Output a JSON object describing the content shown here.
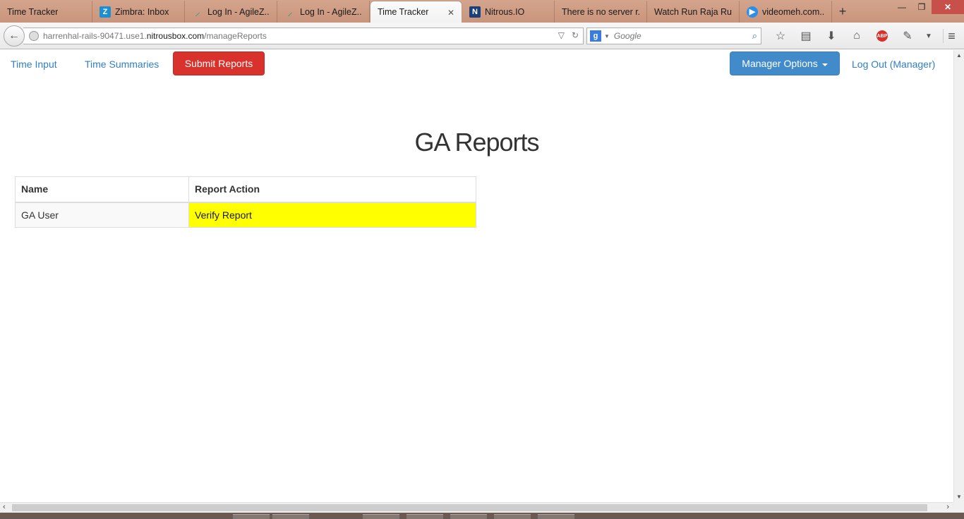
{
  "browser": {
    "tabs": [
      {
        "label": "Time Tracker",
        "icon": "none"
      },
      {
        "label": "Zimbra: Inbox",
        "icon": "zimbra-icon"
      },
      {
        "label": "Log In - AgileZ...",
        "icon": "agilezen-icon"
      },
      {
        "label": "Log In - AgileZ...",
        "icon": "agilezen-icon"
      },
      {
        "label": "Time Tracker",
        "icon": "none",
        "active": true
      },
      {
        "label": "Nitrous.IO",
        "icon": "nitrous-icon"
      },
      {
        "label": "There is no server r...",
        "icon": "none"
      },
      {
        "label": "Watch Run Raja Ru...",
        "icon": "none"
      },
      {
        "label": "videomeh.com...",
        "icon": "video-icon"
      }
    ],
    "url_prefix": "harrenhal-rails-90471.use1.",
    "url_domain": "nitrousbox.com",
    "url_path": "/manageReports",
    "search_placeholder": "Google"
  },
  "nav": {
    "time_input": "Time Input",
    "time_summaries": "Time Summaries",
    "submit_reports": "Submit Reports",
    "manager_options": "Manager Options",
    "log_out": "Log Out (Manager)"
  },
  "page": {
    "title": "GA Reports"
  },
  "table": {
    "headers": {
      "name": "Name",
      "action": "Report Action"
    },
    "rows": [
      {
        "name": "GA User",
        "action": "Verify Report"
      }
    ]
  },
  "colors": {
    "accent_blue": "#428bca",
    "submit_red": "#d9312b",
    "highlight_yellow": "#ffff00",
    "link_blue": "#2f7fc1"
  }
}
